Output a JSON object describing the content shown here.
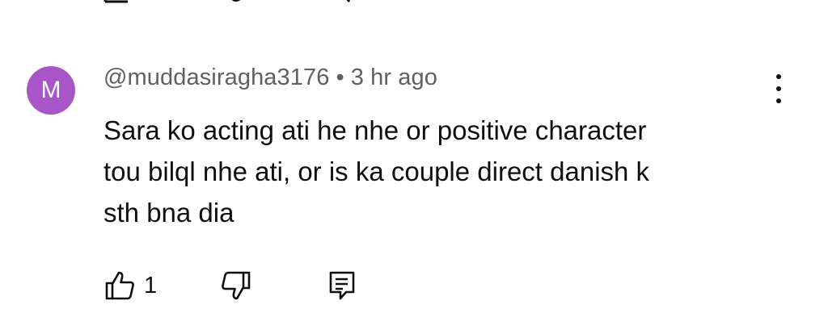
{
  "comment": {
    "avatar_letter": "M",
    "avatar_color": "#a855c8",
    "author": "@muddasiragha3176",
    "separator": "•",
    "time": "3 hr ago",
    "text_lines": [
      "Sara ko acting ati he nhe or positive character",
      "tou bilql nhe ati, or is ka couple direct danish k",
      "sth bna dia"
    ],
    "like_count": "1",
    "icons": {
      "like": "thumbs-up-icon",
      "dislike": "thumbs-down-icon",
      "reply": "reply-comment-icon",
      "menu": "more-vert-icon"
    }
  }
}
